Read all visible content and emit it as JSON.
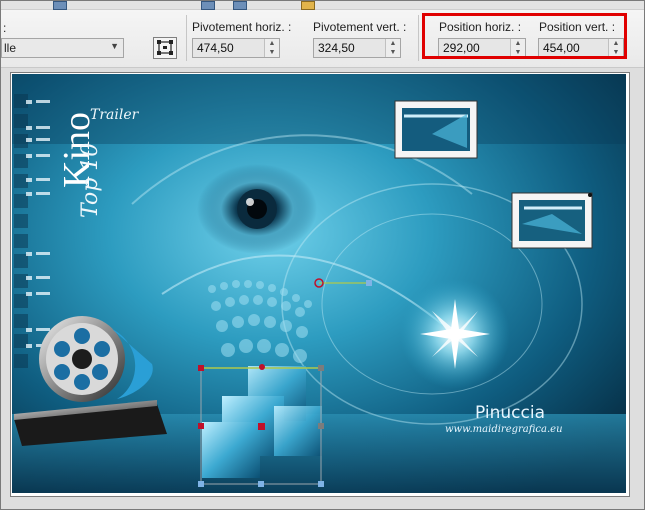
{
  "toolbar": {
    "mode_combo": {
      "value": "lle"
    },
    "colon_text": ":",
    "pivot_h": {
      "label": "Pivotement horiz. :",
      "value": "474,50"
    },
    "pivot_v": {
      "label": "Pivotement vert. :",
      "value": "324,50"
    },
    "pos_h": {
      "label": "Position horiz. :",
      "value": "292,00"
    },
    "pos_v": {
      "label": "Position vert. :",
      "value": "454,00"
    }
  },
  "artwork": {
    "title_kino": "Kino",
    "title_trailer": "Trailer",
    "title_top": "Top 10",
    "signature": "Pinuccia",
    "website": "www.maidiregrafica.eu"
  },
  "colors": {
    "highlight_box": "#e00000",
    "selection_marker": "#c0102a",
    "handle": "#7fb3e6"
  },
  "icons": [
    "pick-tool-icon",
    "film-reel-icon",
    "sparkle-icon"
  ]
}
